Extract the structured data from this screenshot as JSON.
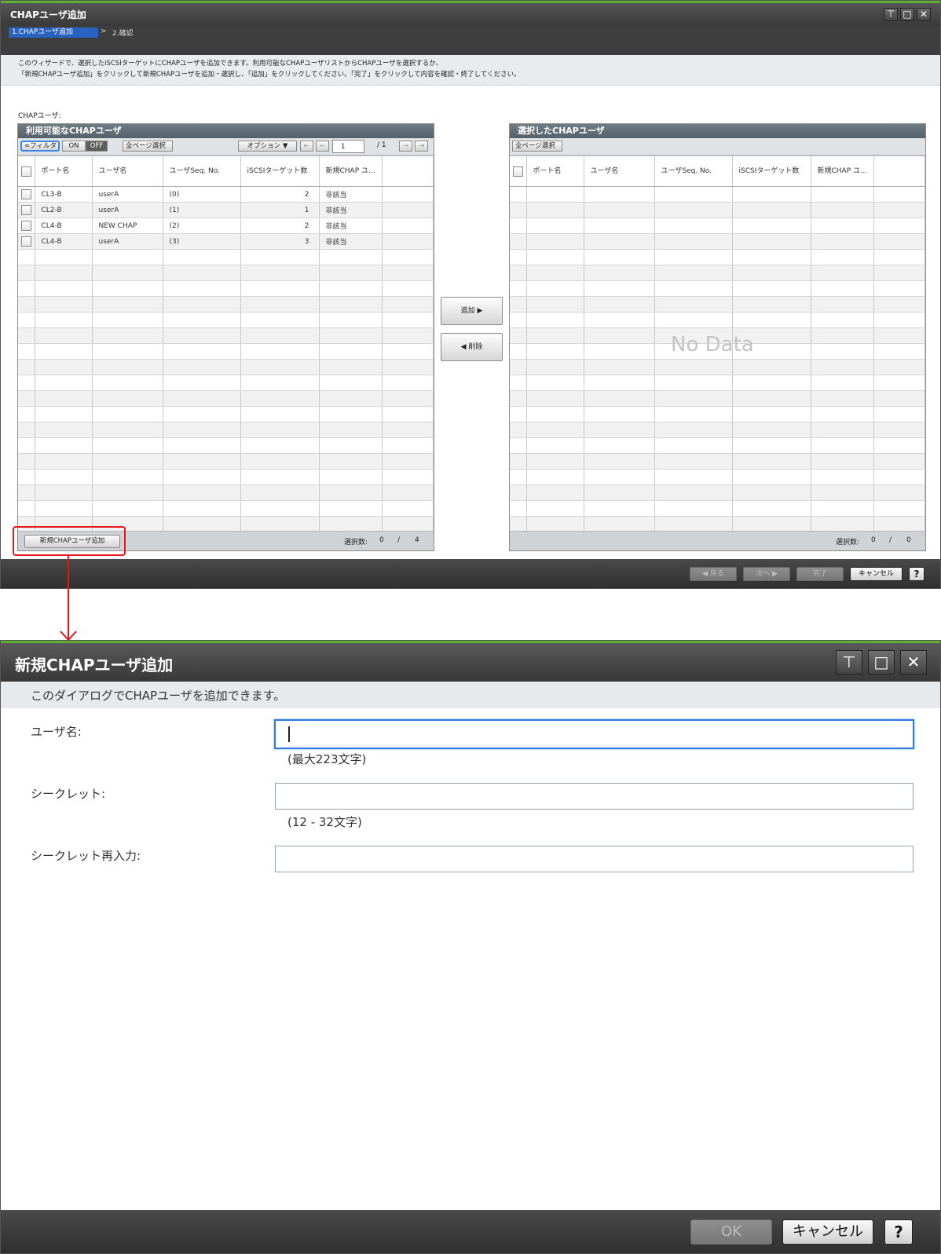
{
  "wizard": {
    "title": "CHAPユーザ追加",
    "steps": {
      "step1": "1.CHAPユーザ追加",
      "separator": ">",
      "step2": "2.確認"
    },
    "description": [
      "このウィザードで、選択したiSCSIターゲットにCHAPユーザを追加できます。利用可能なCHAPユーザリストからCHAPユーザを選択するか、",
      "「新規CHAPユーザ追加」をクリックして新規CHAPユーザを追加・選択し、「追加」をクリックしてください。「完了」をクリックして内容を確認・終了してください。"
    ],
    "section_label": "CHAPユーザ:",
    "available_panel": {
      "title": "利用可能なCHAPユーザ",
      "filter_label": "≈フィルタ",
      "on_label": "ON",
      "off_label": "OFF",
      "select_all_pages": "全ページ選択",
      "options_label": "オプション ▼",
      "page_value": "1",
      "page_total": "/ 1",
      "columns": [
        "ポート名",
        "ユーザ名",
        "ユーザSeq. No.",
        "iSCSIターゲット数",
        "新規CHAP ユ..."
      ],
      "rows": [
        [
          "CL3-B",
          "userA",
          "(0)",
          "2",
          "非該当"
        ],
        [
          "CL2-B",
          "userA",
          "(1)",
          "1",
          "非該当"
        ],
        [
          "CL4-B",
          "NEW CHAP",
          "(2)",
          "2",
          "非該当"
        ],
        [
          "CL4-B",
          "userA",
          "(3)",
          "3",
          "非該当"
        ]
      ],
      "new_button": "新規CHAPユーザ追加",
      "selection_label": "選択数:",
      "selection_count": "0",
      "selection_sep": "/",
      "selection_total": "4"
    },
    "add_button": "追加 ▶",
    "remove_button": "◀ 削除",
    "selected_panel": {
      "title": "選択したCHAPユーザ",
      "select_all_pages": "全ページ選択",
      "columns": [
        "ポート名",
        "ユーザ名",
        "ユーザSeq. No.",
        "iSCSIターゲット数",
        "新規CHAP ユ..."
      ],
      "empty_text": "No Data",
      "selection_label": "選択数:",
      "selection_count": "0",
      "selection_sep": "/",
      "selection_total": "0"
    },
    "footer": {
      "back": "◀ 戻る",
      "next": "次へ ▶",
      "finish": "完了",
      "cancel": "キャンセル",
      "help": "?"
    }
  },
  "dialog": {
    "title": "新規CHAPユーザ追加",
    "description": "このダイアログでCHAPユーザを追加できます。",
    "fields": {
      "user_name_label": "ユーザ名:",
      "user_name_hint": "(最大223文字)",
      "secret_label": "シークレット:",
      "secret_hint": "(12 - 32文字)",
      "secret_confirm_label": "シークレット再入力:"
    },
    "footer": {
      "ok": "OK",
      "cancel": "キャンセル",
      "help": "?"
    }
  },
  "colors": {
    "accent_green": "#5db12f",
    "step_active": "#2a62c2",
    "annotation_red": "#e8161b",
    "focus_blue": "#2d7ae0"
  }
}
